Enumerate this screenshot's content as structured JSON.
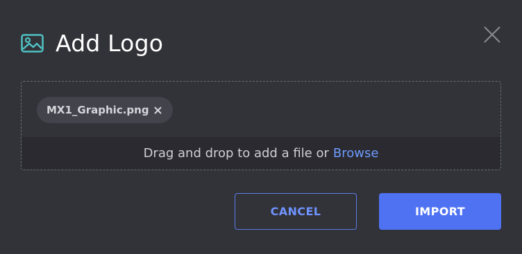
{
  "dialog": {
    "title": "Add Logo",
    "icon": "image-icon",
    "close_icon": "close-icon"
  },
  "dropzone": {
    "file": {
      "name": "MX1_Graphic.png",
      "remove_icon": "close-icon"
    },
    "instruction": "Drag and drop to add a file or",
    "browse_label": "Browse"
  },
  "actions": {
    "cancel_label": "CANCEL",
    "import_label": "IMPORT"
  },
  "colors": {
    "background": "#323239",
    "accent": "#4f72f3",
    "link": "#6f9bff",
    "icon_teal": "#4fc3c3"
  }
}
